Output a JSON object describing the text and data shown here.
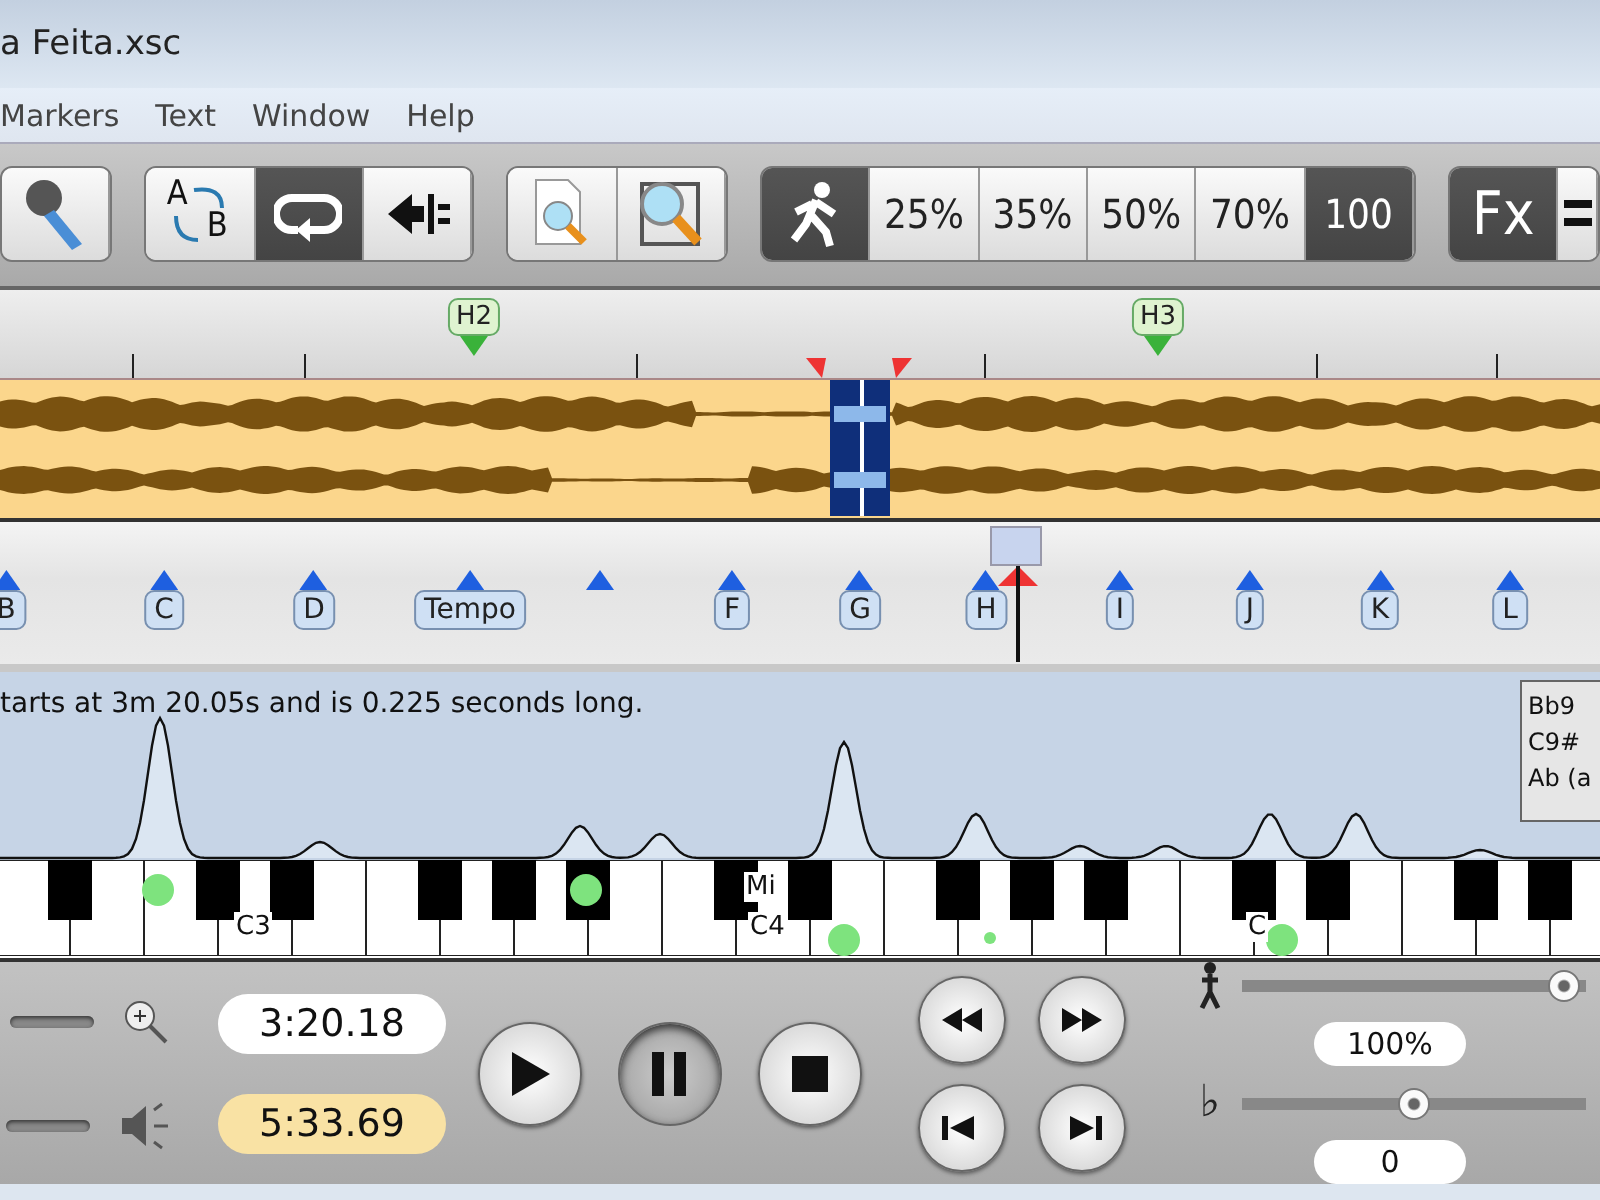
{
  "window": {
    "title": "a Feita.xsc"
  },
  "menu": [
    "Markers",
    "Text",
    "Window",
    "Help"
  ],
  "toolbar": {
    "groups": [
      [
        {
          "kind": "mic",
          "selected": false
        }
      ],
      [
        {
          "kind": "swap",
          "letters": [
            "A",
            "B"
          ],
          "selected": false
        },
        {
          "kind": "loop",
          "selected": true
        },
        {
          "kind": "arrow-bar",
          "selected": false
        }
      ],
      [
        {
          "kind": "page-zoom",
          "selected": false
        },
        {
          "kind": "zoom",
          "selected": false
        }
      ],
      [
        {
          "kind": "runner",
          "selected": true
        },
        {
          "kind": "text",
          "label": "25%",
          "selected": false
        },
        {
          "kind": "text",
          "label": "35%",
          "selected": false
        },
        {
          "kind": "text",
          "label": "50%",
          "selected": false
        },
        {
          "kind": "text",
          "label": "70%",
          "selected": false
        },
        {
          "kind": "text",
          "label": "100",
          "selected": true
        }
      ],
      [
        {
          "kind": "text",
          "label": "Fx",
          "selected": true
        },
        {
          "kind": "lines",
          "selected": false
        }
      ]
    ]
  },
  "overview": {
    "tags": [
      "H2",
      "H3"
    ]
  },
  "markers": [
    {
      "kind": "tag",
      "label": "B"
    },
    {
      "kind": "tag",
      "label": "C"
    },
    {
      "kind": "tag",
      "label": "D"
    },
    {
      "kind": "tag",
      "label": "Tempo"
    },
    {
      "kind": "plain"
    },
    {
      "kind": "tag",
      "label": "F"
    },
    {
      "kind": "tag",
      "label": "G"
    },
    {
      "kind": "tag",
      "label": "H"
    },
    {
      "kind": "tag",
      "label": "I"
    },
    {
      "kind": "tag",
      "label": "J"
    },
    {
      "kind": "tag",
      "label": "K"
    },
    {
      "kind": "tag",
      "label": "L"
    }
  ],
  "spectrum": {
    "status": "tarts at 3m 20.05s and is 0.225 seconds long.",
    "chords": [
      "Bb9",
      "C9#",
      "Ab (a"
    ]
  },
  "piano": {
    "labels": [
      "C3",
      "Mi",
      "C4",
      "C"
    ]
  },
  "transport": {
    "position": {
      "value": "3:20.18",
      "highlighted": false
    },
    "length": {
      "value": "5:33.69",
      "highlighted": true
    },
    "buttons": [
      {
        "kind": "play",
        "selected": false
      },
      {
        "kind": "pause",
        "selected": true
      },
      {
        "kind": "stop",
        "selected": false
      }
    ],
    "small_buttons": [
      {
        "kind": "rewind"
      },
      {
        "kind": "forward"
      },
      {
        "kind": "start"
      },
      {
        "kind": "end"
      }
    ],
    "speed": {
      "level": 0.98,
      "reading": "100%"
    },
    "pitch": {
      "symbol": "♭",
      "level": 0.5,
      "reading": "0"
    }
  }
}
